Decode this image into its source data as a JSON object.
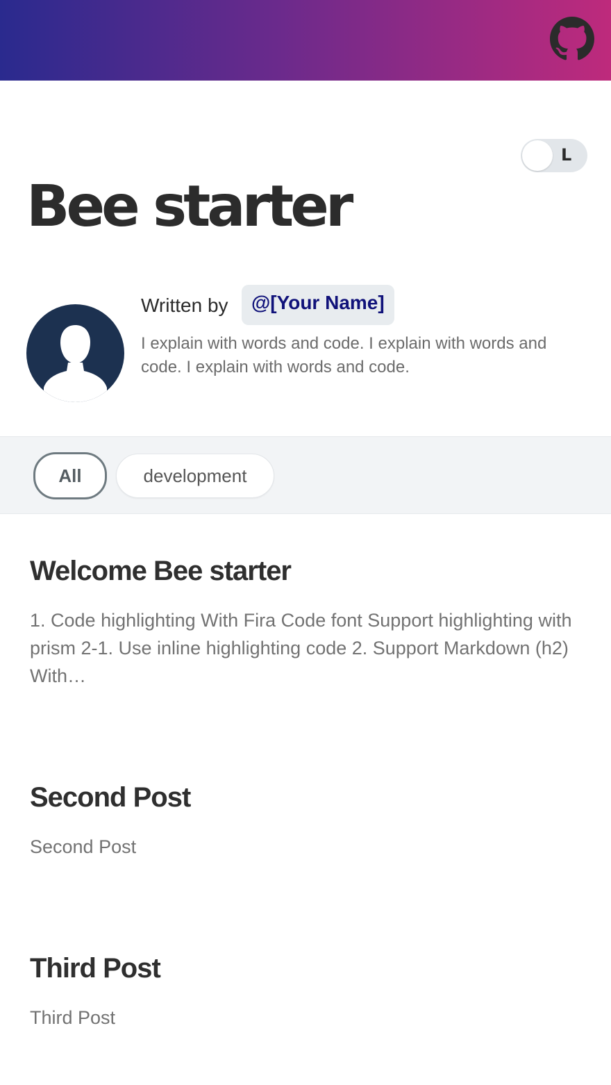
{
  "header": {
    "github_icon": "github-icon",
    "gradient_colors": [
      "#2a2a8e",
      "#be2a7c"
    ]
  },
  "theme_toggle": {
    "label": "L"
  },
  "site": {
    "title": "Bee starter"
  },
  "author": {
    "written_by": "Written by",
    "handle": "@[Your Name]",
    "bio": "I explain with words and code. I explain with words and code. I explain with words and code.",
    "avatar_icon": "user-avatar-icon"
  },
  "tags": [
    {
      "label": "All",
      "active": true
    },
    {
      "label": "development",
      "active": false
    }
  ],
  "posts": [
    {
      "title": "Welcome Bee starter",
      "excerpt": "1. Code highlighting With Fira Code font Support highlighting with prism 2-1. Use inline highlighting code 2. Support Markdown (h2) With…"
    },
    {
      "title": "Second Post",
      "excerpt": "Second Post"
    },
    {
      "title": "Third Post",
      "excerpt": "Third Post"
    }
  ]
}
